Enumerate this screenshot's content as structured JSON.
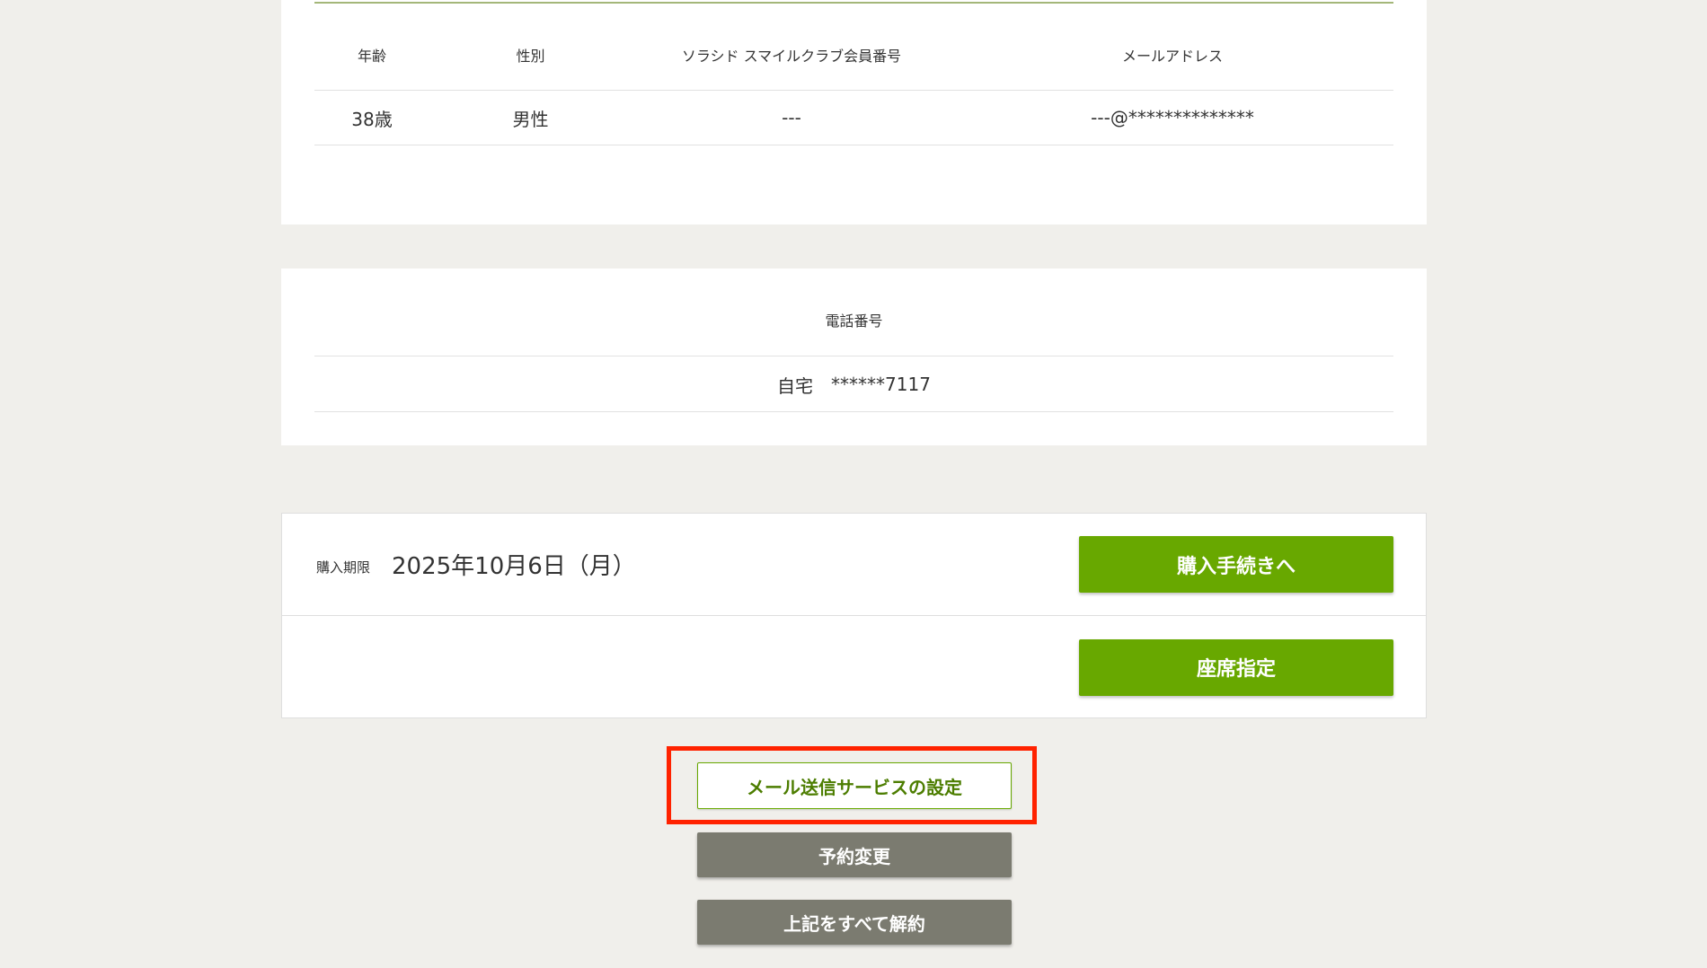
{
  "member": {
    "headers": [
      "年齢",
      "性別",
      "ソラシド スマイルクラブ会員番号",
      "メールアドレス"
    ],
    "values": [
      "38歳",
      "男性",
      "---",
      "---@**************"
    ]
  },
  "phone": {
    "header": "電話番号",
    "type": "自宅",
    "number": "******7117"
  },
  "purchase": {
    "deadline_label": "購入期限",
    "deadline_value": "2025年10月6日（月）",
    "purchase_button": "購入手続きへ",
    "seat_button": "座席指定"
  },
  "actions": {
    "mail_setting_button": "メール送信サービスの設定",
    "change_button": "予約変更",
    "cancel_all_button": "上記をすべて解約"
  },
  "colors": {
    "accent_green": "#68a800",
    "highlight_red": "#ff2200",
    "gray_button": "#7b7b70"
  }
}
